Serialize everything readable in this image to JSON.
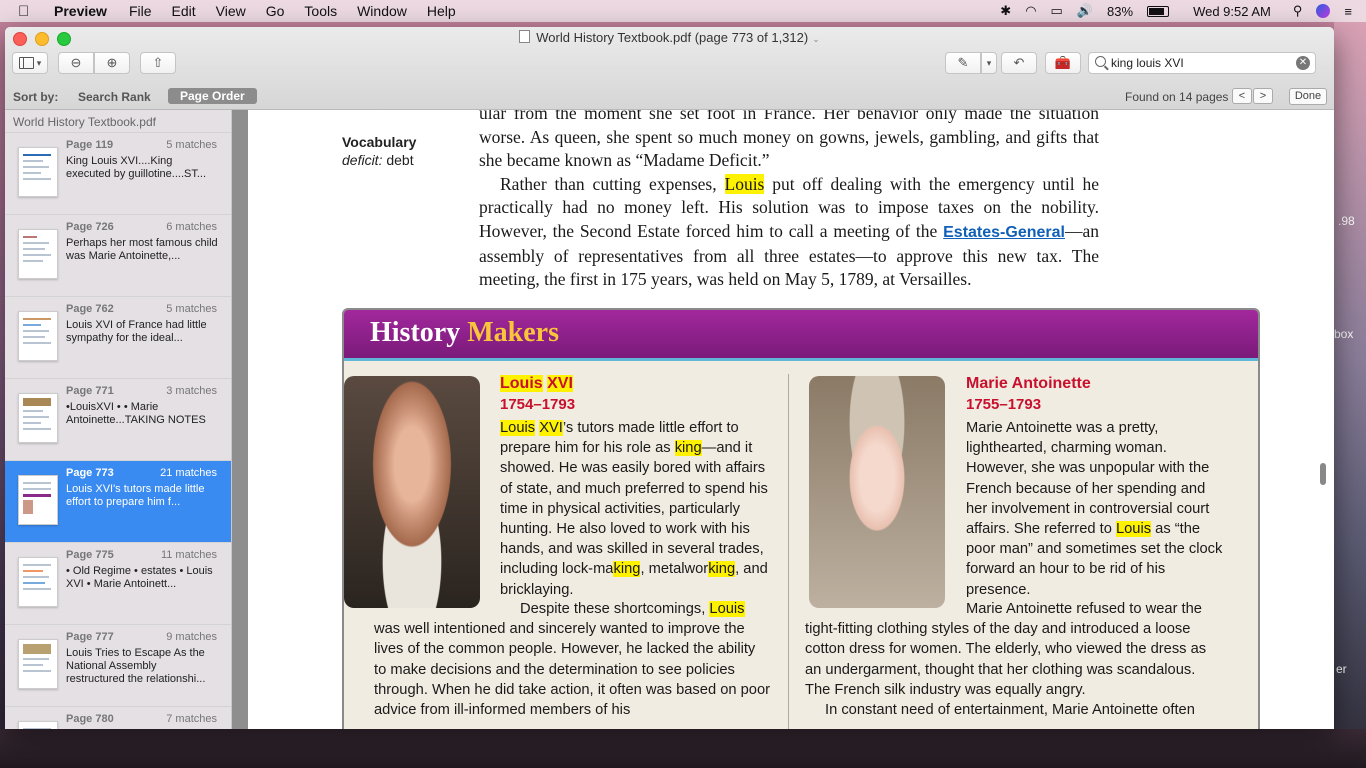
{
  "menubar": {
    "app": "Preview",
    "items": [
      "File",
      "Edit",
      "View",
      "Go",
      "Tools",
      "Window",
      "Help"
    ],
    "battery": "83%",
    "clock": "Wed 9:52 AM"
  },
  "window": {
    "title": "World History Textbook.pdf (page 773 of 1,312)"
  },
  "search": {
    "value": "king louis XVI"
  },
  "sortbar": {
    "label": "Sort by:",
    "search_rank": "Search Rank",
    "page_order": "Page Order",
    "found": "Found on 14 pages",
    "prev": "<",
    "next": ">",
    "done": "Done"
  },
  "sidebar": {
    "file_name": "World History Textbook.pdf",
    "results": [
      {
        "page": "Page 119",
        "matches": "5 matches",
        "snippet": "King Louis XVI....King executed by guillotine....ST..."
      },
      {
        "page": "Page 726",
        "matches": "6 matches",
        "snippet": "Perhaps her most famous child was Marie Antoinette,..."
      },
      {
        "page": "Page 762",
        "matches": "5 matches",
        "snippet": "Louis XVI of France had little sympathy for the ideal..."
      },
      {
        "page": "Page 771",
        "matches": "3 matches",
        "snippet": "•LouisXVI • • Marie Antoinette...TAKING NOTES"
      },
      {
        "page": "Page 773",
        "matches": "21 matches",
        "snippet": "Louis XVI's tutors made little effort to prepare him f..."
      },
      {
        "page": "Page 775",
        "matches": "11 matches",
        "snippet": "• Old Regime • estates • Louis XVI • Marie Antoinett..."
      },
      {
        "page": "Page 777",
        "matches": "9 matches",
        "snippet": "Louis Tries to Escape As the National Assembly restructured the relationshi..."
      },
      {
        "page": "Page 780",
        "matches": "7 matches",
        "snippet": ""
      }
    ]
  },
  "page": {
    "vocab_heading": "Vocabulary",
    "vocab_term": "deficit:",
    "vocab_def": "debt",
    "para1_a": "ular from the moment she set foot in France. Her behavior only made the situation worse. As queen, she spent so much money on gowns, jewels, gambling, and gifts that she became known as “Madame Deficit.”",
    "para2_a": "Rather than cutting expenses, ",
    "para2_hl": "Louis",
    "para2_b": " put off dealing with the emergency until he practically had no money left. His solution was to impose taxes on the nobility. However, the Second Estate forced him to call a meeting of the ",
    "para2_link": "Estates-General",
    "para2_c": "—an assembly of representatives from all three estates—to approve this new tax. The meeting, the first in 175 years, was held on May 5, 1789, at Versailles.",
    "banner_a": "History",
    "banner_b": "Makers",
    "louis": {
      "name_a": "Louis",
      "name_b": "XVI",
      "years": "1754–1793",
      "t1": "Louis",
      "t2": "XVI",
      "t3": "’s tutors made little effort to prepare him for his role as ",
      "t4": "king",
      "t5": "—and it showed. He was easily bored with affairs of state, and much preferred to spend his time in physical activities, particularly hunting. He also loved to work with his hands, and was skilled in several trades, including lock-ma",
      "t6": "king",
      "t7": ", metalwor",
      "t8": "king",
      "t9": ", and bricklaying.",
      "t10": "Despite these shortcomings, ",
      "t11": "Louis",
      "t12": " was well intentioned and sincerely wanted to improve the lives of the common people. However, he lacked the ability to make decisions and the determination to see policies through. When he did take action, it often was based on poor advice from ill-informed members of his"
    },
    "marie": {
      "name": "Marie Antoinette",
      "years": "1755–1793",
      "t1": "Marie Antoinette was a pretty, lighthearted, charming woman. However, she was unpopular with the French because of her spending and her involvement in controversial court affairs. She referred to ",
      "t2": "Louis",
      "t3": " as “the poor man” and sometimes set the clock forward an hour to be rid of his presence.",
      "t4": "Marie Antoinette refused to wear the tight-fitting clothing styles of the day and introduced a loose cotton dress for women. The elderly, who viewed the dress as an undergarment, thought that her clothing was scandalous. The French silk industry was equally angry.",
      "t5": "In constant need of entertainment, Marie Antoinette often"
    }
  },
  "desktop": {
    "label1": ".98",
    "label2": "box",
    "label3": "er"
  }
}
